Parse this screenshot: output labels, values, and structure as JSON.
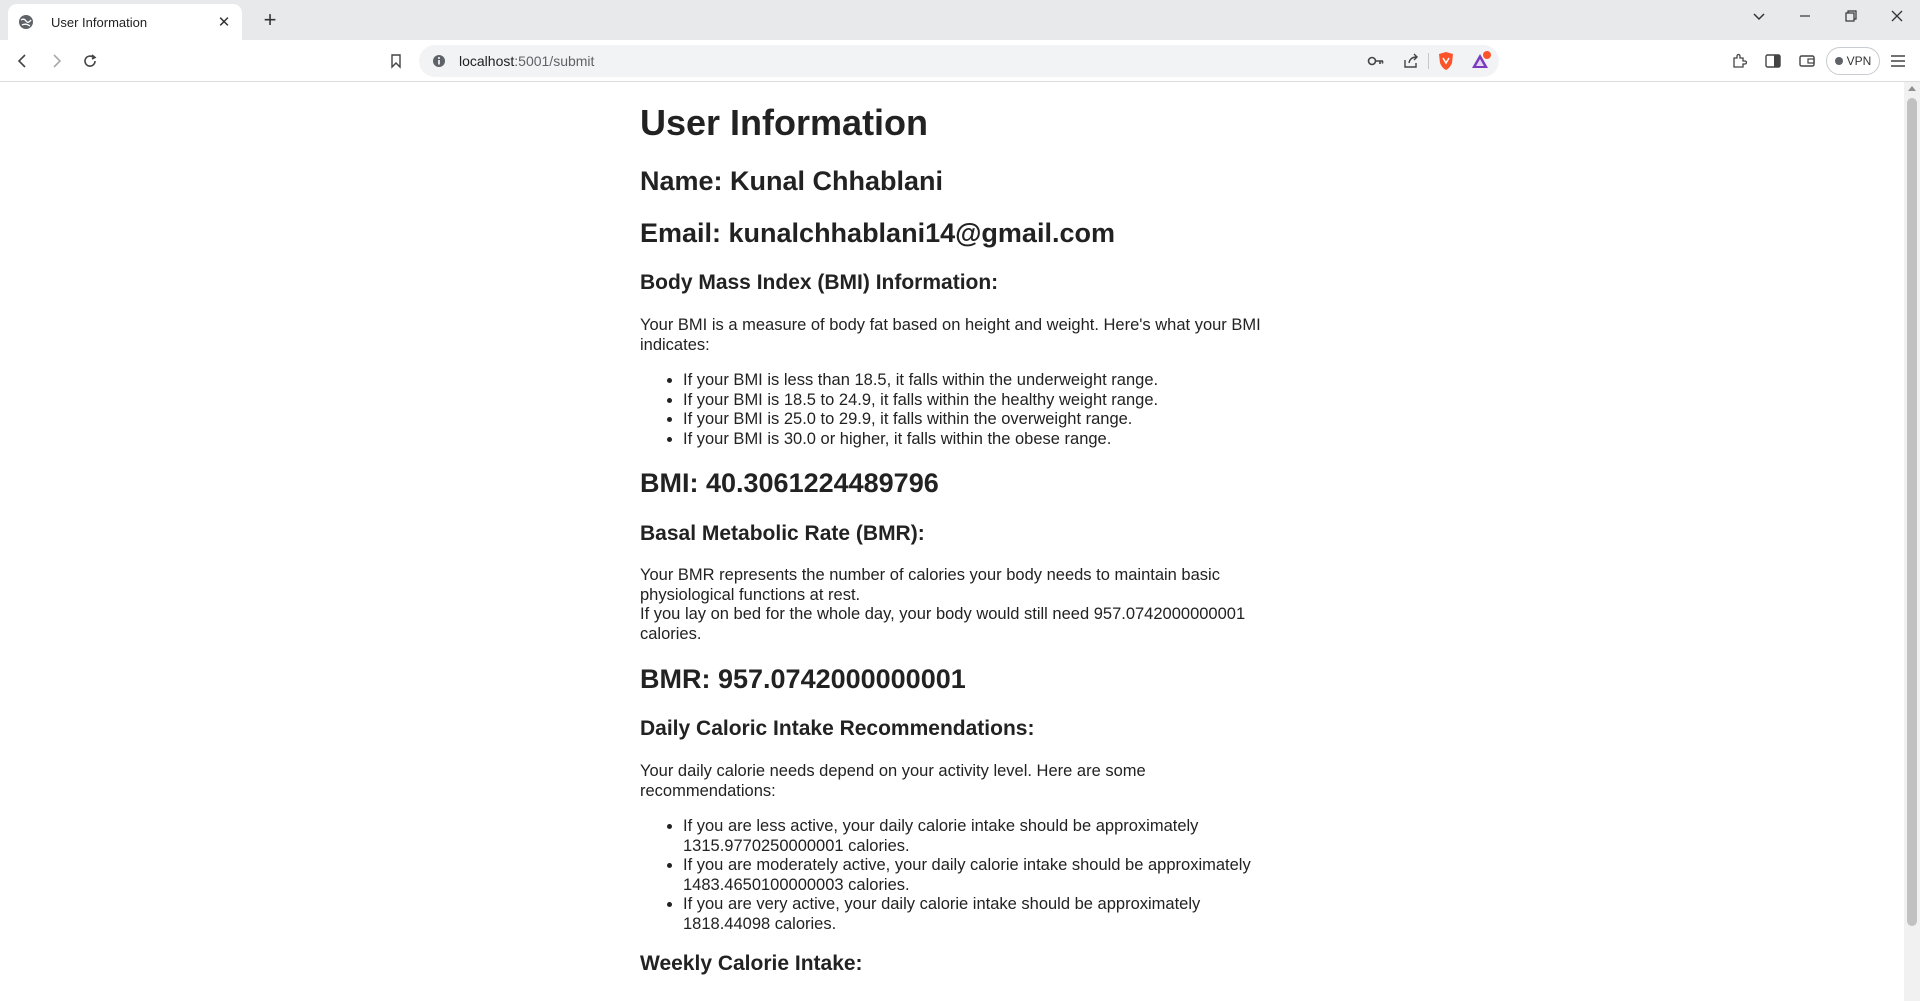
{
  "browser": {
    "tab_title": "User Information",
    "tab_close": "✕",
    "new_tab": "+",
    "url_host": "localhost",
    "url_path": ":5001/submit",
    "vpn_label": "VPN",
    "accent_brave": "#fb542b"
  },
  "page": {
    "title": "User Information",
    "name_line": "Name: Kunal Chhablani",
    "email_line": "Email: kunalchhablani14@gmail.com",
    "bmi_info_heading": "Body Mass Index (BMI) Information:",
    "bmi_intro": "Your BMI is a measure of body fat based on height and weight. Here's what your BMI indicates:",
    "bmi_ranges": [
      "If your BMI is less than 18.5, it falls within the underweight range.",
      "If your BMI is 18.5 to 24.9, it falls within the healthy weight range.",
      "If your BMI is 25.0 to 29.9, it falls within the overweight range.",
      "If your BMI is 30.0 or higher, it falls within the obese range."
    ],
    "bmi_value_line": "BMI: 40.3061224489796",
    "bmr_heading": "Basal Metabolic Rate (BMR):",
    "bmr_desc_1": "Your BMR represents the number of calories your body needs to maintain basic physiological functions at rest.",
    "bmr_desc_2": "If you lay on bed for the whole day, your body would still need 957.0742000000001 calories.",
    "bmr_value_line": "BMR: 957.0742000000001",
    "intake_heading": "Daily Caloric Intake Recommendations:",
    "intake_intro": "Your daily calorie needs depend on your activity level. Here are some recommendations:",
    "intake_items": [
      "If you are less active, your daily calorie intake should be approximately 1315.9770250000001 calories.",
      "If you are moderately active, your daily calorie intake should be approximately 1483.4650100000003 calories.",
      "If you are very active, your daily calorie intake should be approximately 1818.44098 calories."
    ],
    "weekly_heading": "Weekly Calorie Intake:"
  }
}
